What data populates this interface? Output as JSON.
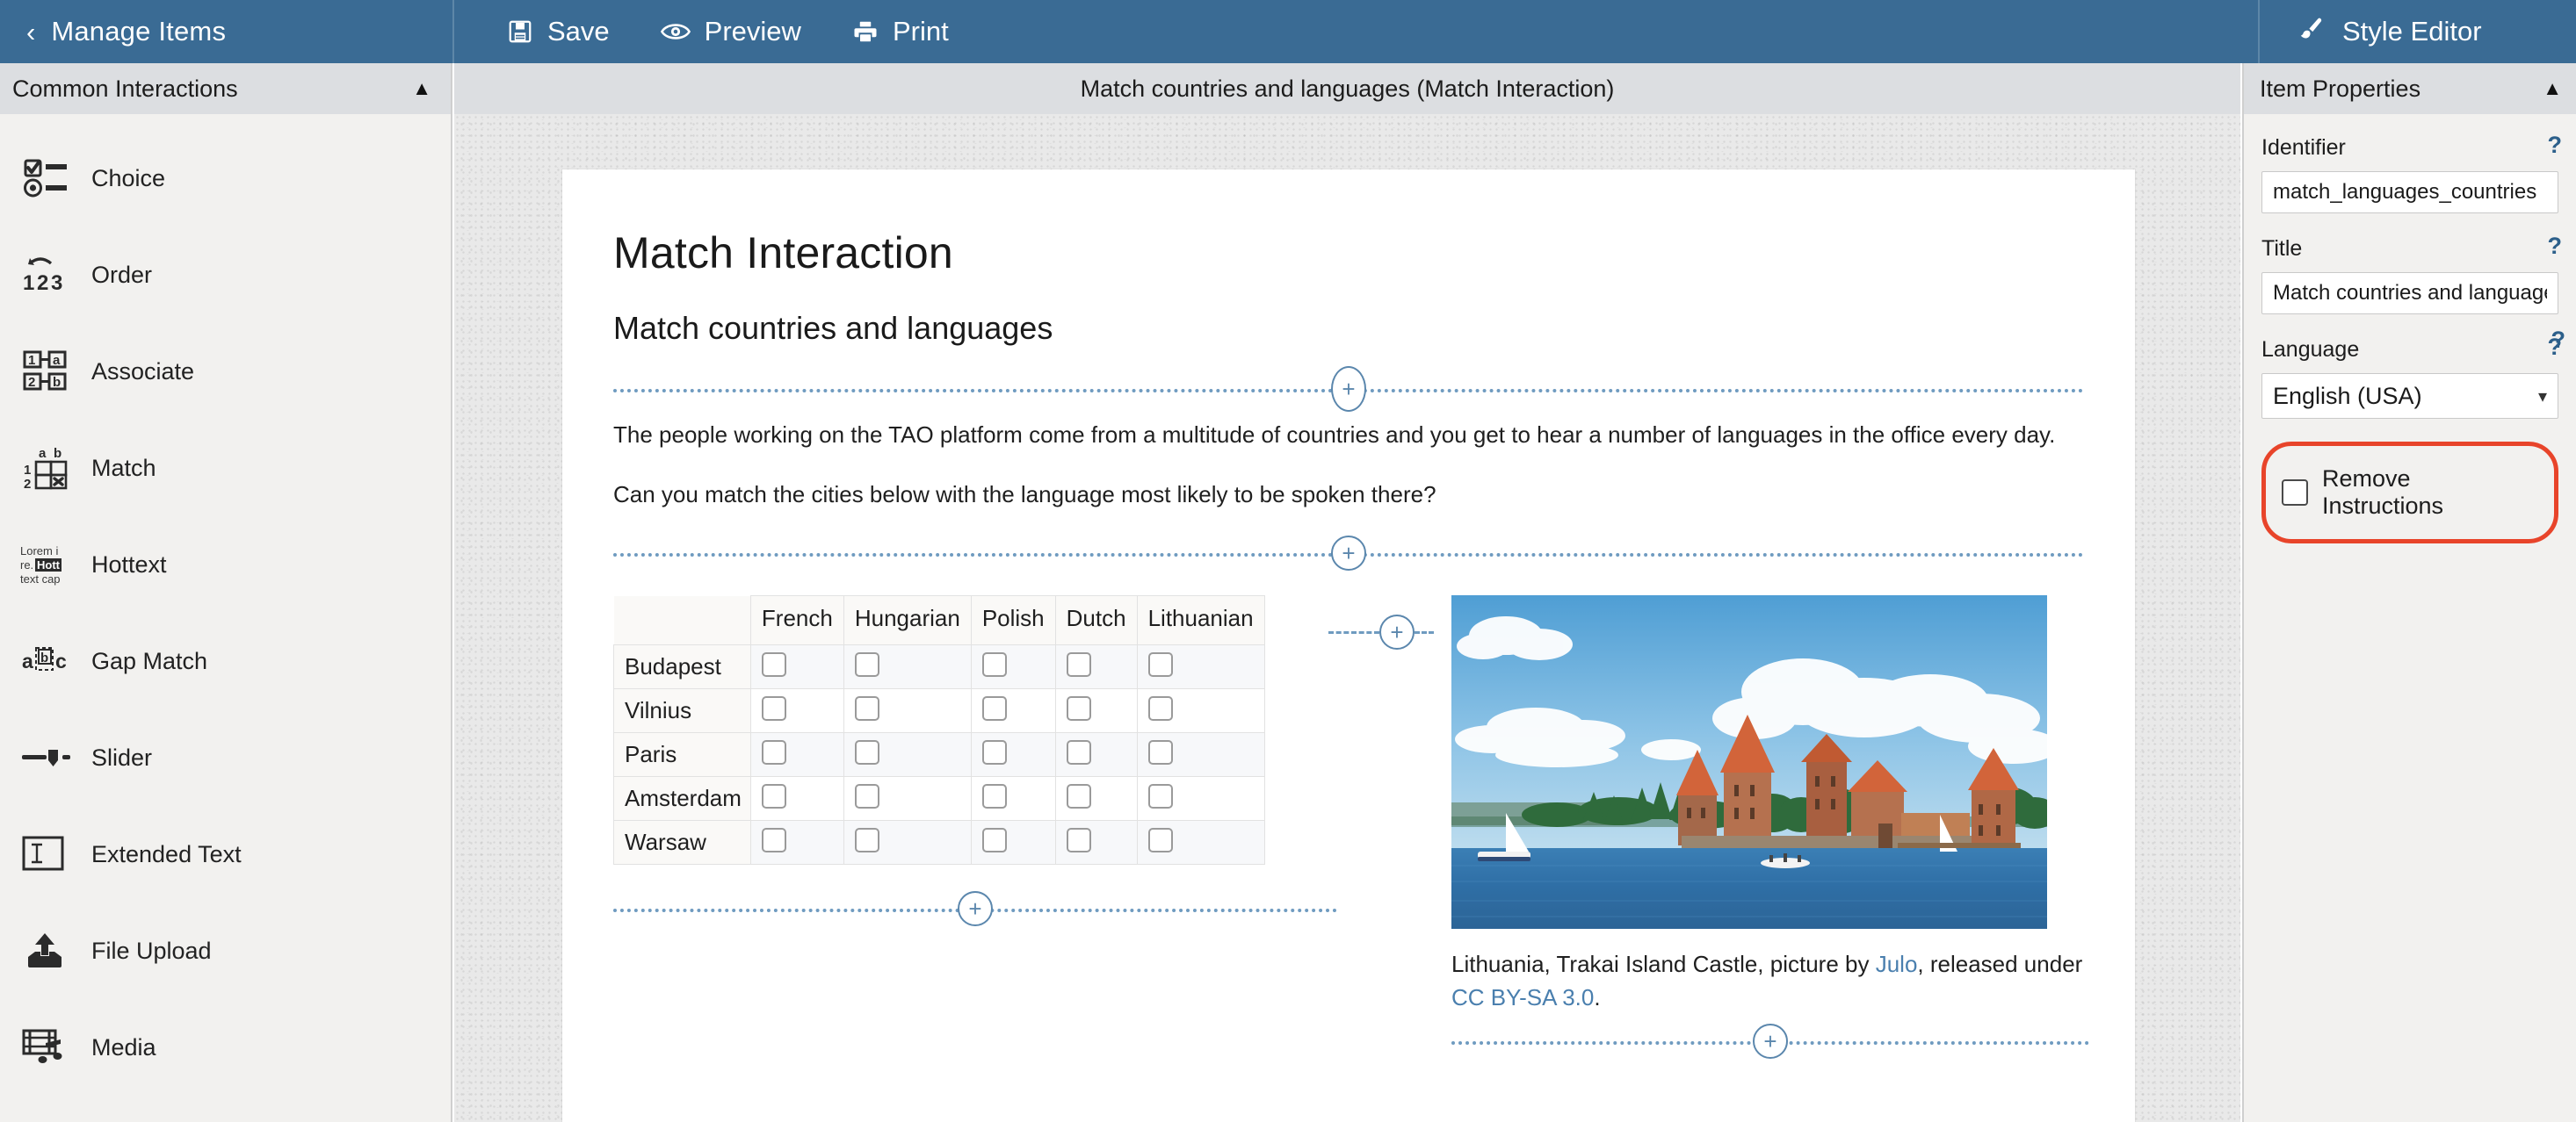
{
  "topbar": {
    "back_label": "Manage Items",
    "back_icon": "chevron-left-icon",
    "actions": [
      {
        "label": "Save",
        "icon": "floppy-disk-icon"
      },
      {
        "label": "Preview",
        "icon": "eye-icon"
      },
      {
        "label": "Print",
        "icon": "printer-icon"
      }
    ],
    "style_editor_label": "Style Editor",
    "style_editor_icon": "paint-brush-icon",
    "bg_color": "#3a6b94"
  },
  "sidebar": {
    "title": "Common Interactions",
    "collapse_icon": "chevron-up-icon",
    "items": [
      {
        "label": "Choice",
        "icon": "choice-icon"
      },
      {
        "label": "Order",
        "icon": "order-icon"
      },
      {
        "label": "Associate",
        "icon": "associate-icon"
      },
      {
        "label": "Match",
        "icon": "match-icon"
      },
      {
        "label": "Hottext",
        "icon": "hottext-icon"
      },
      {
        "label": "Gap Match",
        "icon": "gap-match-icon"
      },
      {
        "label": "Slider",
        "icon": "slider-icon"
      },
      {
        "label": "Extended Text",
        "icon": "extended-text-icon"
      },
      {
        "label": "File Upload",
        "icon": "file-upload-icon"
      },
      {
        "label": "Media",
        "icon": "media-icon"
      }
    ]
  },
  "center": {
    "header_title": "Match countries and languages (Match Interaction)",
    "item_title": "Match Interaction",
    "item_subtitle": "Match countries and languages",
    "paragraph_1": "The people working on the TAO platform come from a multitude of countries and you get to hear a number of languages in the office every day.",
    "paragraph_2": "Can you match the cities below with the language most likely to be spoken there?",
    "insert_icon": "plus-in-circle-icon",
    "table": {
      "corner_label": "",
      "columns": [
        "French",
        "Hungarian",
        "Polish",
        "Dutch",
        "Lithuanian"
      ],
      "rows": [
        "Budapest",
        "Vilnius",
        "Paris",
        "Amsterdam",
        "Warsaw"
      ],
      "checked": [
        [
          false,
          false,
          false,
          false,
          false
        ],
        [
          false,
          false,
          false,
          false,
          false
        ],
        [
          false,
          false,
          false,
          false,
          false
        ],
        [
          false,
          false,
          false,
          false,
          false
        ],
        [
          false,
          false,
          false,
          false,
          false
        ]
      ]
    },
    "figure": {
      "alt": "Trakai Island Castle on a lake under a blue sky with clouds and sailboats",
      "caption_pre": "Lithuania, Trakai Island Castle, picture by ",
      "caption_link1": "Julo",
      "caption_mid": ", released under ",
      "caption_link2": "CC BY-SA 3.0",
      "caption_post": "."
    }
  },
  "properties": {
    "title": "Item Properties",
    "collapse_icon": "chevron-up-icon",
    "help_icon": "question-mark-icon",
    "identifier_label": "Identifier",
    "identifier_value": "match_languages_countries",
    "title_label": "Title",
    "title_value": "Match countries and languages (Match Interaction)",
    "language_label": "Language",
    "language_value": "English (USA)",
    "language_caret_icon": "chevron-down-icon",
    "remove_instructions_label": "Remove Instructions",
    "remove_instructions_checked": false,
    "highlight_color": "#e8442a"
  }
}
